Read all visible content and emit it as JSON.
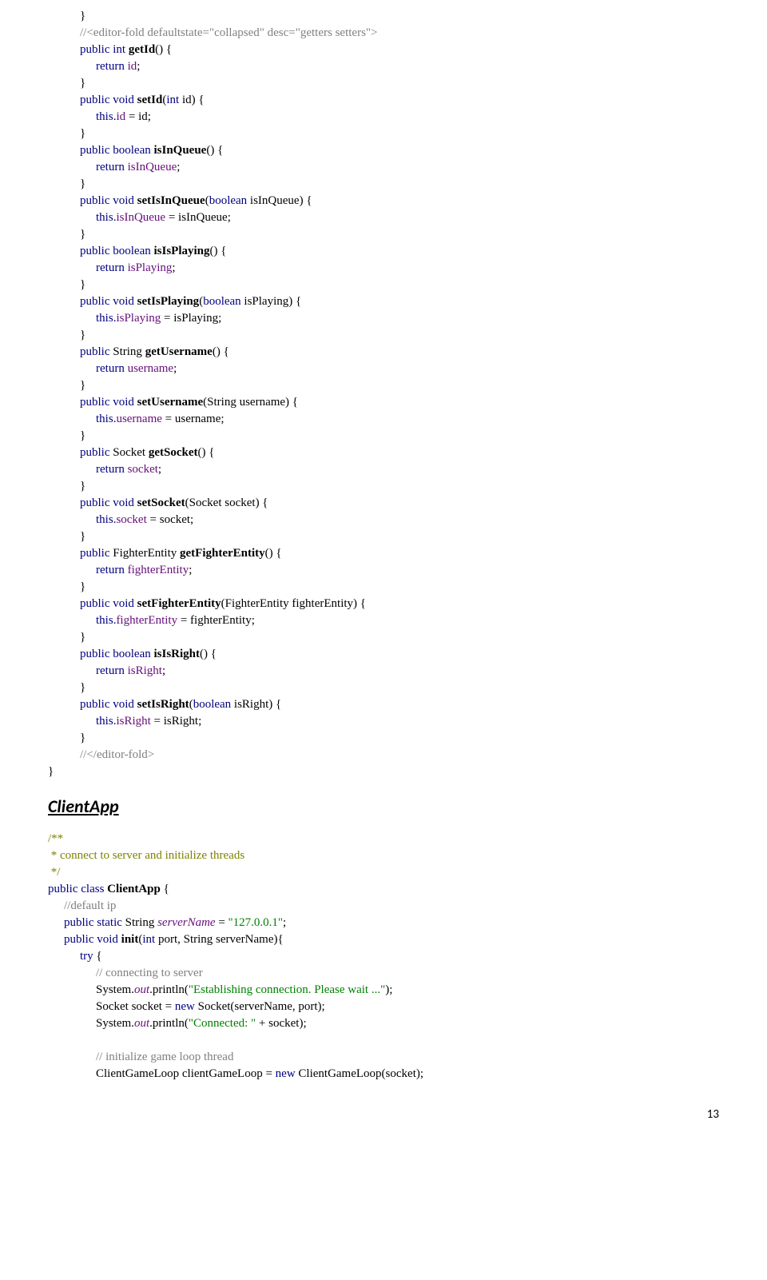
{
  "code1": [
    {
      "cls": "i1",
      "spans": [
        {
          "t": "}"
        }
      ]
    },
    {
      "cls": "i1",
      "spans": [
        {
          "t": "//<editor-fold defaultstate=\"collapsed\" desc=\"getters setters\">",
          "c": "comment"
        }
      ]
    },
    {
      "cls": "i1",
      "spans": [
        {
          "t": "public int ",
          "c": "kw"
        },
        {
          "t": "getId",
          "b": true
        },
        {
          "t": "() {"
        }
      ]
    },
    {
      "cls": "i2",
      "spans": [
        {
          "t": "return ",
          "c": "kw"
        },
        {
          "t": "id",
          "c": "field"
        },
        {
          "t": ";"
        }
      ]
    },
    {
      "cls": "i1",
      "spans": [
        {
          "t": "}"
        }
      ]
    },
    {
      "cls": "i1",
      "spans": [
        {
          "t": "public void ",
          "c": "kw"
        },
        {
          "t": "setId",
          "b": true
        },
        {
          "t": "("
        },
        {
          "t": "int ",
          "c": "kw"
        },
        {
          "t": "id) {"
        }
      ]
    },
    {
      "cls": "i2",
      "spans": [
        {
          "t": "this",
          "c": "kw"
        },
        {
          "t": ".",
          "c": "kw"
        },
        {
          "t": "id ",
          "c": "field"
        },
        {
          "t": "= id;"
        }
      ]
    },
    {
      "cls": "i1",
      "spans": [
        {
          "t": "}"
        }
      ]
    },
    {
      "cls": "i1",
      "spans": [
        {
          "t": "public boolean ",
          "c": "kw"
        },
        {
          "t": "isInQueue",
          "b": true
        },
        {
          "t": "() {"
        }
      ]
    },
    {
      "cls": "i2",
      "spans": [
        {
          "t": "return ",
          "c": "kw"
        },
        {
          "t": "isInQueue",
          "c": "field"
        },
        {
          "t": ";"
        }
      ]
    },
    {
      "cls": "i1",
      "spans": [
        {
          "t": "}"
        }
      ]
    },
    {
      "cls": "i1",
      "spans": [
        {
          "t": "public void ",
          "c": "kw"
        },
        {
          "t": "setIsInQueue",
          "b": true
        },
        {
          "t": "("
        },
        {
          "t": "boolean ",
          "c": "kw"
        },
        {
          "t": "isInQueue) {"
        }
      ]
    },
    {
      "cls": "i2",
      "spans": [
        {
          "t": "this",
          "c": "kw"
        },
        {
          "t": ".",
          "c": "kw"
        },
        {
          "t": "isInQueue ",
          "c": "field"
        },
        {
          "t": "= isInQueue;"
        }
      ]
    },
    {
      "cls": "i1",
      "spans": [
        {
          "t": "}"
        }
      ]
    },
    {
      "cls": "i1",
      "spans": [
        {
          "t": "public boolean ",
          "c": "kw"
        },
        {
          "t": "isIsPlaying",
          "b": true
        },
        {
          "t": "() {"
        }
      ]
    },
    {
      "cls": "i2",
      "spans": [
        {
          "t": "return ",
          "c": "kw"
        },
        {
          "t": "isPlaying",
          "c": "field"
        },
        {
          "t": ";"
        }
      ]
    },
    {
      "cls": "i1",
      "spans": [
        {
          "t": "}"
        }
      ]
    },
    {
      "cls": "i1",
      "spans": [
        {
          "t": "public void ",
          "c": "kw"
        },
        {
          "t": "setIsPlaying",
          "b": true
        },
        {
          "t": "("
        },
        {
          "t": "boolean ",
          "c": "kw"
        },
        {
          "t": "isPlaying) {"
        }
      ]
    },
    {
      "cls": "i2",
      "spans": [
        {
          "t": "this",
          "c": "kw"
        },
        {
          "t": ".",
          "c": "kw"
        },
        {
          "t": "isPlaying ",
          "c": "field"
        },
        {
          "t": "= isPlaying;"
        }
      ]
    },
    {
      "cls": "i1",
      "spans": [
        {
          "t": "}"
        }
      ]
    },
    {
      "cls": "i1",
      "spans": [
        {
          "t": "public ",
          "c": "kw"
        },
        {
          "t": "String "
        },
        {
          "t": "getUsername",
          "b": true
        },
        {
          "t": "() {"
        }
      ]
    },
    {
      "cls": "i2",
      "spans": [
        {
          "t": "return ",
          "c": "kw"
        },
        {
          "t": "username",
          "c": "field"
        },
        {
          "t": ";"
        }
      ]
    },
    {
      "cls": "i1",
      "spans": [
        {
          "t": "}"
        }
      ]
    },
    {
      "cls": "i1",
      "spans": [
        {
          "t": "public void ",
          "c": "kw"
        },
        {
          "t": "setUsername",
          "b": true
        },
        {
          "t": "(String username) {"
        }
      ]
    },
    {
      "cls": "i2",
      "spans": [
        {
          "t": "this",
          "c": "kw"
        },
        {
          "t": ".",
          "c": "kw"
        },
        {
          "t": "username ",
          "c": "field"
        },
        {
          "t": "= username;"
        }
      ]
    },
    {
      "cls": "i1",
      "spans": [
        {
          "t": "}"
        }
      ]
    },
    {
      "cls": "i1",
      "spans": [
        {
          "t": "public ",
          "c": "kw"
        },
        {
          "t": "Socket "
        },
        {
          "t": "getSocket",
          "b": true
        },
        {
          "t": "() {"
        }
      ]
    },
    {
      "cls": "i2",
      "spans": [
        {
          "t": "return ",
          "c": "kw"
        },
        {
          "t": "socket",
          "c": "field"
        },
        {
          "t": ";"
        }
      ]
    },
    {
      "cls": "i1",
      "spans": [
        {
          "t": "}"
        }
      ]
    },
    {
      "cls": "i1",
      "spans": [
        {
          "t": "public void ",
          "c": "kw"
        },
        {
          "t": "setSocket",
          "b": true
        },
        {
          "t": "(Socket socket) {"
        }
      ]
    },
    {
      "cls": "i2",
      "spans": [
        {
          "t": "this",
          "c": "kw"
        },
        {
          "t": ".",
          "c": "kw"
        },
        {
          "t": "socket ",
          "c": "field"
        },
        {
          "t": "= socket;"
        }
      ]
    },
    {
      "cls": "i1",
      "spans": [
        {
          "t": "}"
        }
      ]
    },
    {
      "cls": "i1",
      "spans": [
        {
          "t": "public ",
          "c": "kw"
        },
        {
          "t": "FighterEntity "
        },
        {
          "t": "getFighterEntity",
          "b": true
        },
        {
          "t": "() {"
        }
      ]
    },
    {
      "cls": "i2",
      "spans": [
        {
          "t": "return ",
          "c": "kw"
        },
        {
          "t": "fighterEntity",
          "c": "field"
        },
        {
          "t": ";"
        }
      ]
    },
    {
      "cls": "i1",
      "spans": [
        {
          "t": "}"
        }
      ]
    },
    {
      "cls": "i1",
      "spans": [
        {
          "t": "public void ",
          "c": "kw"
        },
        {
          "t": "setFighterEntity",
          "b": true
        },
        {
          "t": "(FighterEntity fighterEntity) {"
        }
      ]
    },
    {
      "cls": "i2",
      "spans": [
        {
          "t": "this",
          "c": "kw"
        },
        {
          "t": ".",
          "c": "kw"
        },
        {
          "t": "fighterEntity ",
          "c": "field"
        },
        {
          "t": "= fighterEntity;"
        }
      ]
    },
    {
      "cls": "i1",
      "spans": [
        {
          "t": "}"
        }
      ]
    },
    {
      "cls": "i1",
      "spans": [
        {
          "t": "public boolean ",
          "c": "kw"
        },
        {
          "t": "isIsRight",
          "b": true
        },
        {
          "t": "() {"
        }
      ]
    },
    {
      "cls": "i2",
      "spans": [
        {
          "t": "return ",
          "c": "kw"
        },
        {
          "t": "isRight",
          "c": "field"
        },
        {
          "t": ";"
        }
      ]
    },
    {
      "cls": "i1",
      "spans": [
        {
          "t": "}"
        }
      ]
    },
    {
      "cls": "i1",
      "spans": [
        {
          "t": "public void ",
          "c": "kw"
        },
        {
          "t": "setIsRight",
          "b": true
        },
        {
          "t": "("
        },
        {
          "t": "boolean ",
          "c": "kw"
        },
        {
          "t": "isRight) {"
        }
      ]
    },
    {
      "cls": "i2",
      "spans": [
        {
          "t": "this",
          "c": "kw"
        },
        {
          "t": ".",
          "c": "kw"
        },
        {
          "t": "isRight ",
          "c": "field"
        },
        {
          "t": "= isRight;"
        }
      ]
    },
    {
      "cls": "i1",
      "spans": [
        {
          "t": "}"
        }
      ]
    },
    {
      "cls": "i1",
      "spans": [
        {
          "t": "//</editor-fold>",
          "c": "comment"
        }
      ]
    },
    {
      "cls": "",
      "spans": [
        {
          "t": "}"
        }
      ]
    }
  ],
  "heading": "ClientApp",
  "code2": [
    {
      "cls": "i0b",
      "spans": [
        {
          "t": "/**",
          "c": "annot"
        }
      ]
    },
    {
      "cls": "i0b",
      "spans": [
        {
          "t": " * connect to server and initialize threads",
          "c": "annot"
        }
      ]
    },
    {
      "cls": "i0b",
      "spans": [
        {
          "t": " */",
          "c": "annot"
        }
      ]
    },
    {
      "cls": "i0b",
      "spans": [
        {
          "t": "public class ",
          "c": "kw"
        },
        {
          "t": "ClientApp ",
          "b": true
        },
        {
          "t": "{"
        }
      ]
    },
    {
      "cls": "i1b",
      "spans": [
        {
          "t": "//default ip",
          "c": "comment"
        }
      ]
    },
    {
      "cls": "i1b",
      "spans": [
        {
          "t": "public static ",
          "c": "kw"
        },
        {
          "t": "String "
        },
        {
          "t": "serverName ",
          "c": "field",
          "i": true
        },
        {
          "t": "= "
        },
        {
          "t": "\"127.0.0.1\"",
          "c": "str"
        },
        {
          "t": ";"
        }
      ]
    },
    {
      "cls": "i1b",
      "spans": [
        {
          "t": "public void ",
          "c": "kw"
        },
        {
          "t": "init",
          "b": true
        },
        {
          "t": "("
        },
        {
          "t": "int ",
          "c": "kw"
        },
        {
          "t": "port, String serverName){"
        }
      ]
    },
    {
      "cls": "i2b",
      "spans": [
        {
          "t": "try ",
          "c": "kw"
        },
        {
          "t": "{"
        }
      ]
    },
    {
      "cls": "i3b",
      "spans": [
        {
          "t": "// connecting to server",
          "c": "comment"
        }
      ]
    },
    {
      "cls": "i3b",
      "spans": [
        {
          "t": "System."
        },
        {
          "t": "out",
          "c": "field",
          "i": true
        },
        {
          "t": ".println("
        },
        {
          "t": "\"Establishing connection. Please wait ...\"",
          "c": "str"
        },
        {
          "t": ");"
        }
      ]
    },
    {
      "cls": "i3b",
      "spans": [
        {
          "t": "Socket socket = "
        },
        {
          "t": "new ",
          "c": "kw"
        },
        {
          "t": "Socket(serverName, port);"
        }
      ]
    },
    {
      "cls": "i3b",
      "spans": [
        {
          "t": "System."
        },
        {
          "t": "out",
          "c": "field",
          "i": true
        },
        {
          "t": ".println("
        },
        {
          "t": "\"Connected: \" ",
          "c": "str"
        },
        {
          "t": "+ socket);"
        }
      ]
    },
    {
      "cls": "i3b",
      "spans": [
        {
          "t": " "
        }
      ]
    },
    {
      "cls": "i3b",
      "spans": [
        {
          "t": "// initialize game loop thread",
          "c": "comment"
        }
      ]
    },
    {
      "cls": "i3b",
      "spans": [
        {
          "t": "ClientGameLoop clientGameLoop = "
        },
        {
          "t": "new ",
          "c": "kw"
        },
        {
          "t": "ClientGameLoop(socket);"
        }
      ]
    }
  ],
  "pagenum": "13"
}
